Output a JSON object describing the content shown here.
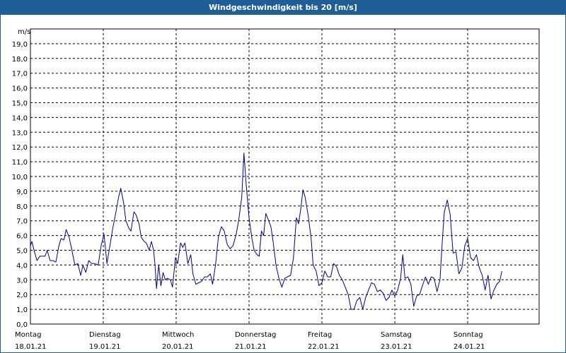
{
  "window": {
    "title": "Windgeschwindigkeit bis 20 [m/s]"
  },
  "colors": {
    "titlebar": "#1f5d96",
    "line": "#00008b",
    "grid": "#000000"
  },
  "chart_data": {
    "type": "line",
    "title": "Windgeschwindigkeit bis 20 [m/s]",
    "ylabel": "m/s",
    "ylim": [
      0,
      20
    ],
    "yticks": [
      "0,0",
      "1,0",
      "2,0",
      "3,0",
      "4,0",
      "5,0",
      "6,0",
      "7,0",
      "8,0",
      "9,0",
      "10,0",
      "11,0",
      "12,0",
      "13,0",
      "14,0",
      "15,0",
      "16,0",
      "17,0",
      "18,0",
      "19,0"
    ],
    "xlim": [
      0,
      7
    ],
    "day_labels": [
      {
        "day": "Montag",
        "date": "18.01.21"
      },
      {
        "day": "Dienstag",
        "date": "19.01.21"
      },
      {
        "day": "Mittwoch",
        "date": "20.01.21"
      },
      {
        "day": "Donnerstag",
        "date": "21.01.21"
      },
      {
        "day": "Freitag",
        "date": "22.01.21"
      },
      {
        "day": "Samstag",
        "date": "23.01.21"
      },
      {
        "day": "Sonntag",
        "date": "24.01.21"
      }
    ],
    "grid": true,
    "series": [
      {
        "values": [
          [
            0.0,
            5.3
          ],
          [
            0.02,
            5.6
          ],
          [
            0.05,
            5.0
          ],
          [
            0.09,
            4.3
          ],
          [
            0.13,
            4.6
          ],
          [
            0.17,
            4.6
          ],
          [
            0.2,
            4.6
          ],
          [
            0.23,
            5.0
          ],
          [
            0.27,
            4.3
          ],
          [
            0.31,
            4.3
          ],
          [
            0.35,
            4.2
          ],
          [
            0.39,
            5.3
          ],
          [
            0.42,
            5.8
          ],
          [
            0.46,
            5.7
          ],
          [
            0.49,
            6.4
          ],
          [
            0.53,
            5.9
          ],
          [
            0.57,
            5.0
          ],
          [
            0.61,
            4.0
          ],
          [
            0.65,
            4.1
          ],
          [
            0.69,
            3.3
          ],
          [
            0.72,
            4.0
          ],
          [
            0.76,
            3.5
          ],
          [
            0.8,
            4.3
          ],
          [
            0.84,
            4.1
          ],
          [
            0.88,
            4.1
          ],
          [
            0.93,
            4.0
          ],
          [
            0.97,
            5.3
          ],
          [
            1.01,
            6.1
          ],
          [
            1.05,
            4.1
          ],
          [
            1.09,
            5.3
          ],
          [
            1.13,
            6.5
          ],
          [
            1.17,
            7.5
          ],
          [
            1.21,
            8.6
          ],
          [
            1.24,
            9.2
          ],
          [
            1.28,
            8.2
          ],
          [
            1.31,
            7.0
          ],
          [
            1.35,
            6.5
          ],
          [
            1.38,
            6.3
          ],
          [
            1.42,
            7.6
          ],
          [
            1.45,
            7.4
          ],
          [
            1.49,
            6.8
          ],
          [
            1.52,
            5.9
          ],
          [
            1.56,
            5.6
          ],
          [
            1.59,
            5.5
          ],
          [
            1.63,
            5.0
          ],
          [
            1.66,
            5.6
          ],
          [
            1.69,
            5.0
          ],
          [
            1.71,
            4.0
          ],
          [
            1.73,
            2.4
          ],
          [
            1.76,
            4.0
          ],
          [
            1.79,
            2.6
          ],
          [
            1.82,
            3.5
          ],
          [
            1.85,
            3.0
          ],
          [
            1.88,
            3.1
          ],
          [
            1.92,
            3.0
          ],
          [
            1.95,
            2.5
          ],
          [
            1.99,
            4.5
          ],
          [
            2.02,
            4.1
          ],
          [
            2.06,
            5.5
          ],
          [
            2.09,
            5.2
          ],
          [
            2.12,
            5.5
          ],
          [
            2.16,
            4.1
          ],
          [
            2.2,
            4.7
          ],
          [
            2.23,
            3.4
          ],
          [
            2.27,
            2.7
          ],
          [
            2.31,
            2.8
          ],
          [
            2.35,
            2.9
          ],
          [
            2.39,
            3.2
          ],
          [
            2.43,
            3.2
          ],
          [
            2.47,
            3.4
          ],
          [
            2.5,
            2.7
          ],
          [
            2.54,
            4.0
          ],
          [
            2.58,
            5.9
          ],
          [
            2.62,
            6.6
          ],
          [
            2.66,
            6.3
          ],
          [
            2.7,
            5.4
          ],
          [
            2.74,
            5.1
          ],
          [
            2.78,
            5.3
          ],
          [
            2.82,
            6.0
          ],
          [
            2.86,
            7.1
          ],
          [
            2.9,
            8.6
          ],
          [
            2.93,
            11.6
          ],
          [
            2.96,
            9.5
          ],
          [
            3.0,
            7.2
          ],
          [
            3.04,
            5.8
          ],
          [
            3.07,
            5.0
          ],
          [
            3.11,
            4.7
          ],
          [
            3.14,
            4.6
          ],
          [
            3.17,
            6.3
          ],
          [
            3.2,
            6.0
          ],
          [
            3.23,
            7.5
          ],
          [
            3.27,
            7.0
          ],
          [
            3.3,
            6.6
          ],
          [
            3.33,
            5.6
          ],
          [
            3.37,
            4.0
          ],
          [
            3.41,
            3.1
          ],
          [
            3.45,
            2.5
          ],
          [
            3.49,
            3.1
          ],
          [
            3.53,
            3.2
          ],
          [
            3.57,
            3.3
          ],
          [
            3.61,
            4.5
          ],
          [
            3.65,
            7.2
          ],
          [
            3.68,
            6.8
          ],
          [
            3.71,
            7.8
          ],
          [
            3.74,
            9.1
          ],
          [
            3.77,
            8.6
          ],
          [
            3.81,
            7.4
          ],
          [
            3.85,
            5.9
          ],
          [
            3.88,
            4.0
          ],
          [
            3.92,
            3.6
          ],
          [
            3.96,
            2.6
          ],
          [
            4.0,
            2.8
          ],
          [
            4.04,
            3.6
          ],
          [
            4.08,
            3.2
          ],
          [
            4.12,
            3.2
          ],
          [
            4.16,
            4.1
          ],
          [
            4.2,
            3.9
          ],
          [
            4.24,
            3.3
          ],
          [
            4.28,
            3.0
          ],
          [
            4.32,
            2.5
          ],
          [
            4.36,
            2.0
          ],
          [
            4.4,
            1.0
          ],
          [
            4.44,
            1.0
          ],
          [
            4.48,
            1.6
          ],
          [
            4.52,
            1.8
          ],
          [
            4.56,
            1.0
          ],
          [
            4.6,
            1.8
          ],
          [
            4.64,
            2.3
          ],
          [
            4.68,
            2.8
          ],
          [
            4.72,
            2.7
          ],
          [
            4.76,
            2.2
          ],
          [
            4.8,
            2.3
          ],
          [
            4.84,
            2.1
          ],
          [
            4.88,
            1.6
          ],
          [
            4.92,
            1.8
          ],
          [
            4.96,
            2.3
          ],
          [
            5.0,
            1.9
          ],
          [
            5.04,
            2.3
          ],
          [
            5.08,
            3.1
          ],
          [
            5.11,
            4.7
          ],
          [
            5.14,
            3.1
          ],
          [
            5.18,
            3.2
          ],
          [
            5.22,
            2.7
          ],
          [
            5.26,
            1.2
          ],
          [
            5.3,
            1.9
          ],
          [
            5.34,
            2.0
          ],
          [
            5.38,
            2.6
          ],
          [
            5.42,
            3.2
          ],
          [
            5.46,
            2.7
          ],
          [
            5.5,
            3.2
          ],
          [
            5.54,
            3.1
          ],
          [
            5.58,
            2.2
          ],
          [
            5.62,
            3.0
          ],
          [
            5.65,
            5.5
          ],
          [
            5.68,
            7.6
          ],
          [
            5.72,
            8.4
          ],
          [
            5.76,
            7.4
          ],
          [
            5.8,
            4.8
          ],
          [
            5.84,
            4.9
          ],
          [
            5.88,
            3.4
          ],
          [
            5.92,
            3.8
          ],
          [
            5.96,
            5.3
          ],
          [
            6.0,
            5.8
          ],
          [
            6.04,
            4.5
          ],
          [
            6.08,
            4.3
          ],
          [
            6.12,
            4.7
          ],
          [
            6.16,
            3.8
          ],
          [
            6.2,
            3.3
          ],
          [
            6.24,
            2.3
          ],
          [
            6.28,
            3.3
          ],
          [
            6.32,
            1.7
          ],
          [
            6.36,
            2.3
          ],
          [
            6.4,
            2.7
          ],
          [
            6.44,
            2.9
          ],
          [
            6.47,
            3.6
          ]
        ]
      }
    ]
  }
}
